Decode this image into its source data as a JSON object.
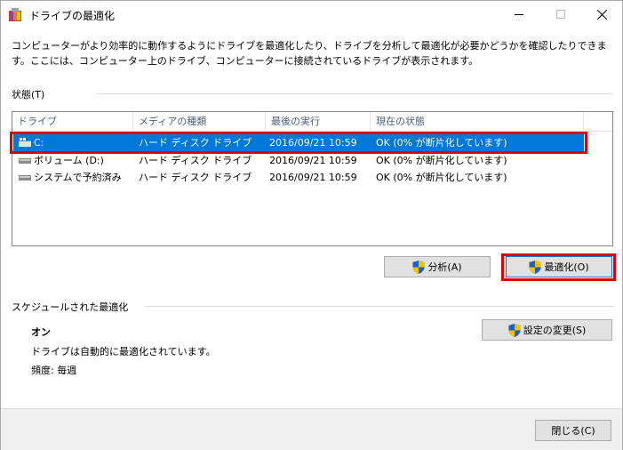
{
  "window": {
    "title": "ドライブの最適化",
    "minimize": "minimize",
    "maximize": "maximize",
    "close": "close"
  },
  "description": "コンピューターがより効率的に動作するようにドライブを最適化したり、ドライブを分析して最適化が必要かどうかを確認したりできます。ここには、コンピューター上のドライブ、コンピューターに接続されているドライブが表示されます。",
  "status_label": "状態(T)",
  "columns": [
    "ドライブ",
    "メディアの種類",
    "最後の実行",
    "現在の状態"
  ],
  "drives": [
    {
      "name": "C:",
      "media": "ハード ディスク ドライブ",
      "last_run": "2016/09/21 10:59",
      "status": "OK (0% が断片化しています)",
      "selected": true
    },
    {
      "name": "ボリューム (D:)",
      "media": "ハード ディスク ドライブ",
      "last_run": "2016/09/21 10:59",
      "status": "OK (0% が断片化しています)",
      "selected": false
    },
    {
      "name": "システムで予約済み",
      "media": "ハード ディスク ドライブ",
      "last_run": "2016/09/21 10:59",
      "status": "OK (0% が断片化しています)",
      "selected": false
    }
  ],
  "buttons": {
    "analyze": "分析(A)",
    "optimize": "最適化(O)",
    "change_settings": "設定の変更(S)",
    "close": "閉じる(C)"
  },
  "schedule": {
    "label": "スケジュールされた最適化",
    "state": "オン",
    "auto_text": "ドライブは自動的に最適化されています。",
    "frequency": "頻度: 毎週"
  },
  "colors": {
    "selection": "#0078d7",
    "highlight": "#e00000",
    "shield_blue": "#1f5fbf",
    "shield_yellow": "#f2c200"
  }
}
